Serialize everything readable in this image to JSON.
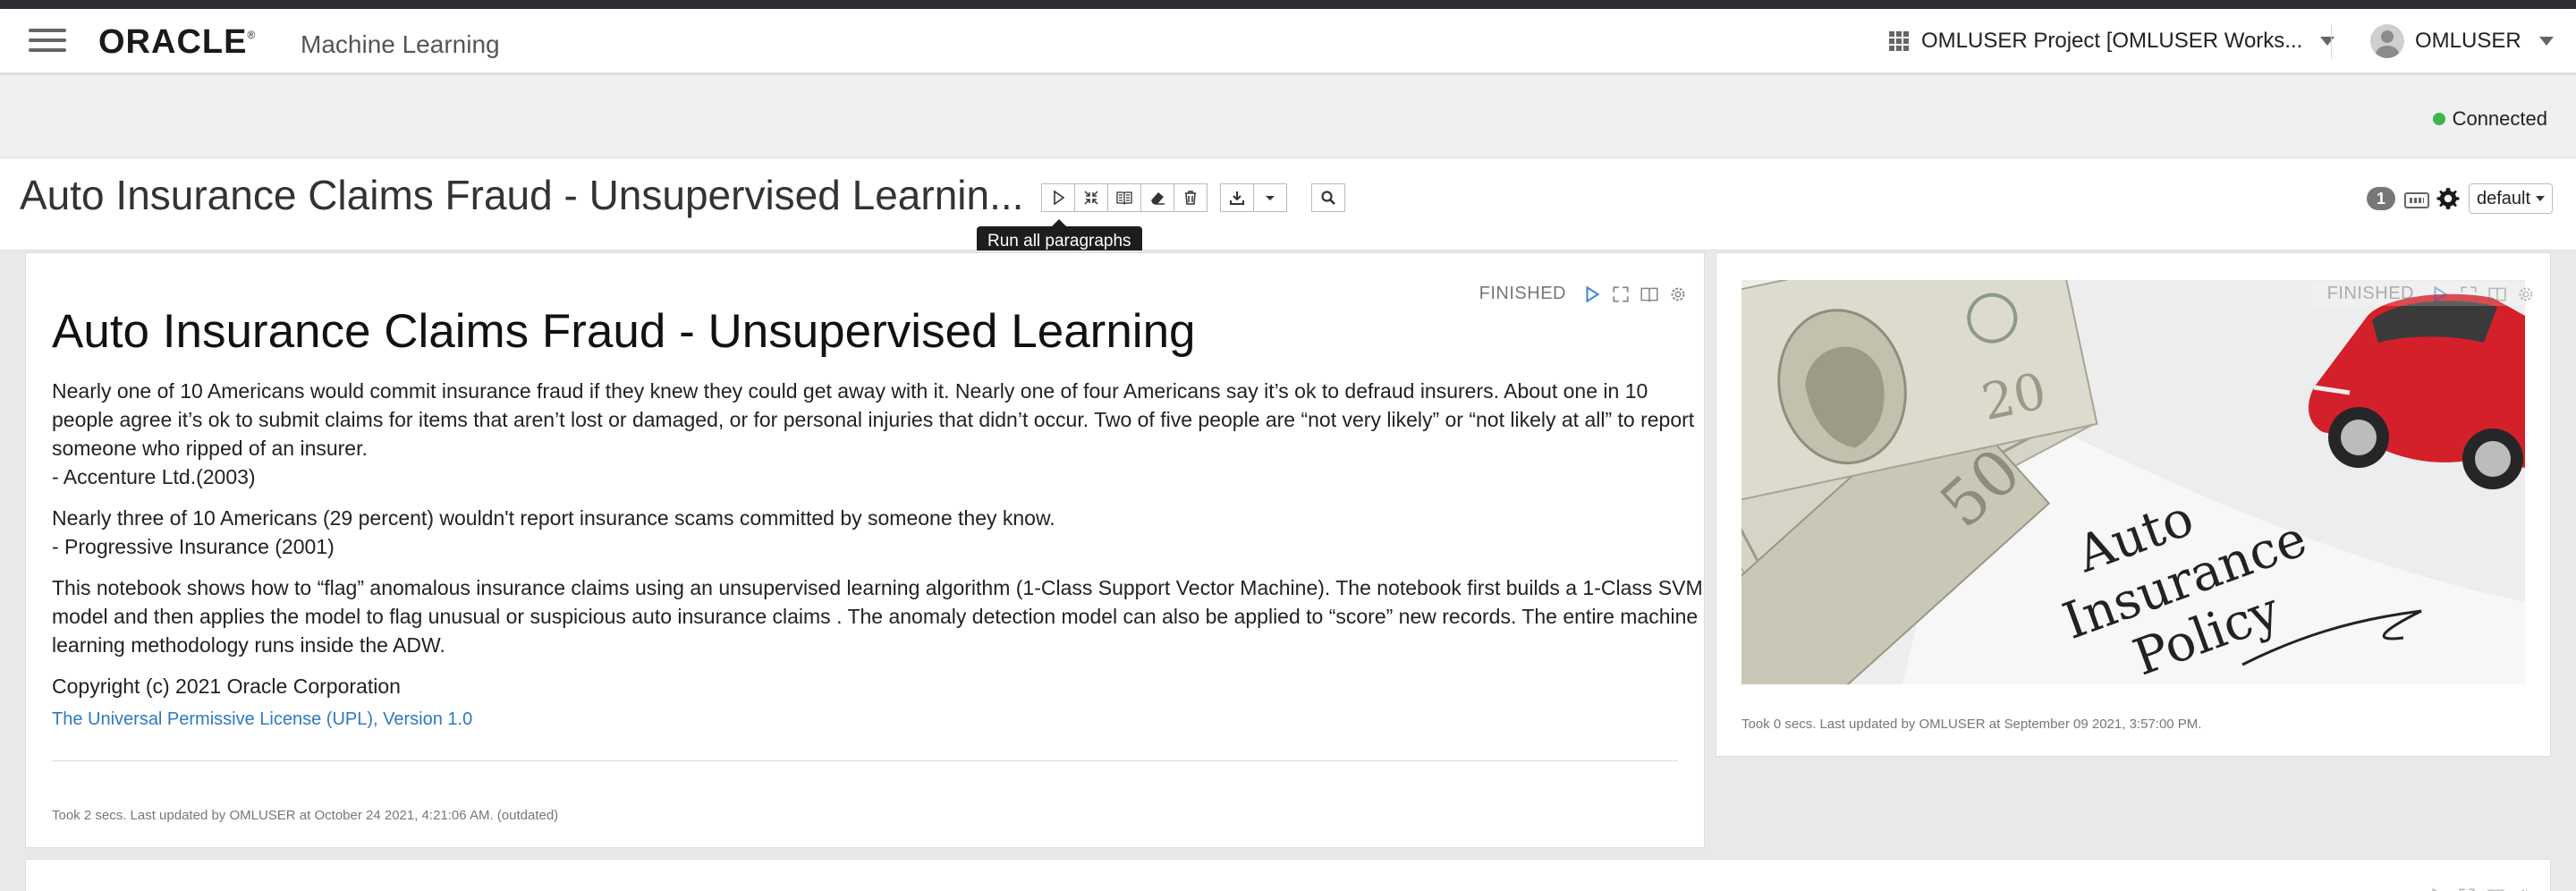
{
  "app": {
    "brand": "ORACLE",
    "product": "Machine Learning",
    "project_selector": "OMLUSER Project [OMLUSER Works...",
    "user": "OMLUSER"
  },
  "status": {
    "connection": "Connected",
    "connection_color": "#3cb64b"
  },
  "notebook": {
    "title": "Auto Insurance Claims Fraud - Unsupervised Learnin...",
    "tooltip": "Run all paragraphs",
    "badge_count": "1",
    "interpreter_binding": "default",
    "toolbar_icons": [
      "run-all-icon",
      "collapse-icon",
      "book-icon",
      "eraser-icon",
      "trash-icon",
      "download-icon",
      "dropdown-caret-icon",
      "search-icon"
    ]
  },
  "paragraphs": [
    {
      "status": "FINISHED",
      "heading": "Auto Insurance Claims Fraud - Unsupervised Learning",
      "body": [
        "Nearly one of 10 Americans would commit insurance fraud if they knew they could get away with it. Nearly one of four Americans say it’s ok to defraud insurers. About one in 10 people agree it’s ok to submit claims for items that aren’t lost or damaged, or for personal injuries that didn’t occur. Two of five people are “not very likely” or “not likely at all” to report someone who ripped of an insurer.",
        "- Accenture Ltd.(2003)",
        "Nearly three of 10 Americans (29 percent) wouldn't report insurance scams committed by someone they know.",
        "- Progressive Insurance (2001)",
        "This notebook shows how to “flag” anomalous insurance claims using an unsupervised learning algorithm (1-Class Support Vector Machine). The notebook first builds a 1-Class SVM model and then applies the model to flag unusual or suspicious auto insurance claims . The anomaly detection model can also be applied to “score” new records. The entire machine learning methodology runs inside the ADW.",
        "Copyright (c) 2021 Oracle Corporation"
      ],
      "link": "The Universal Permissive License (UPL), Version 1.0",
      "footer": "Took 2 secs. Last updated by OMLUSER at October 24 2021, 4:21:06 AM. (outdated)"
    },
    {
      "status": "FINISHED",
      "image_caption_text": [
        "Auto",
        "Insurance",
        "Policy"
      ],
      "footer": "Took 0 secs. Last updated by OMLUSER at September 09 2021, 3:57:00 PM."
    }
  ]
}
